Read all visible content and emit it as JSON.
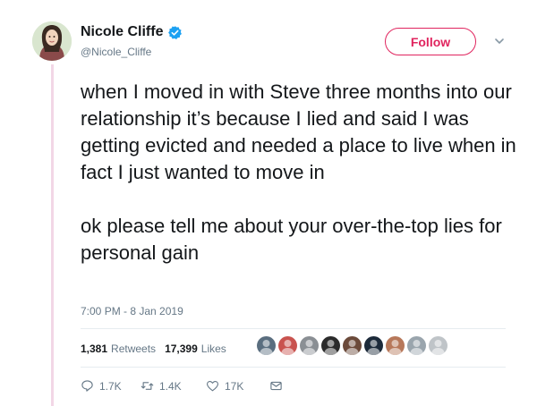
{
  "author": {
    "name": "Nicole Cliffe",
    "handle": "@Nicole_Cliffe",
    "verified": true,
    "follow_label": "Follow"
  },
  "tweet": {
    "paragraphs": [
      "when I moved in with Steve three months into our relationship it’s because I lied and said I was getting evicted and needed a place to live when in fact I just wanted to move in",
      "ok please tell me about your over-the-top lies for personal gain"
    ],
    "timestamp": "7:00 PM - 8 Jan 2019"
  },
  "stats": {
    "retweets_count": "1,381",
    "retweets_label": "Retweets",
    "likes_count": "17,399",
    "likes_label": "Likes"
  },
  "liker_avatars": [
    {
      "icon": "avatar-icon",
      "color": "#5a6e7f"
    },
    {
      "icon": "avatar-icon",
      "color": "#c9534f"
    },
    {
      "icon": "avatar-icon",
      "color": "#8a8f94"
    },
    {
      "icon": "avatar-icon",
      "color": "#2b2b2b"
    },
    {
      "icon": "avatar-icon",
      "color": "#6b4a3a"
    },
    {
      "icon": "avatar-icon",
      "color": "#1c2a3a"
    },
    {
      "icon": "avatar-icon",
      "color": "#b7785a"
    },
    {
      "icon": "avatar-icon",
      "color": "#9aa5ad"
    },
    {
      "icon": "avatar-icon",
      "color": "#bfc4c8"
    }
  ],
  "actions": {
    "reply_count": "1.7K",
    "retweet_count": "1.4K",
    "like_count": "17K"
  },
  "colors": {
    "accent": "#e0245e",
    "verified": "#1da1f2",
    "muted": "#657786",
    "thread_line": "#f2d7e6"
  }
}
